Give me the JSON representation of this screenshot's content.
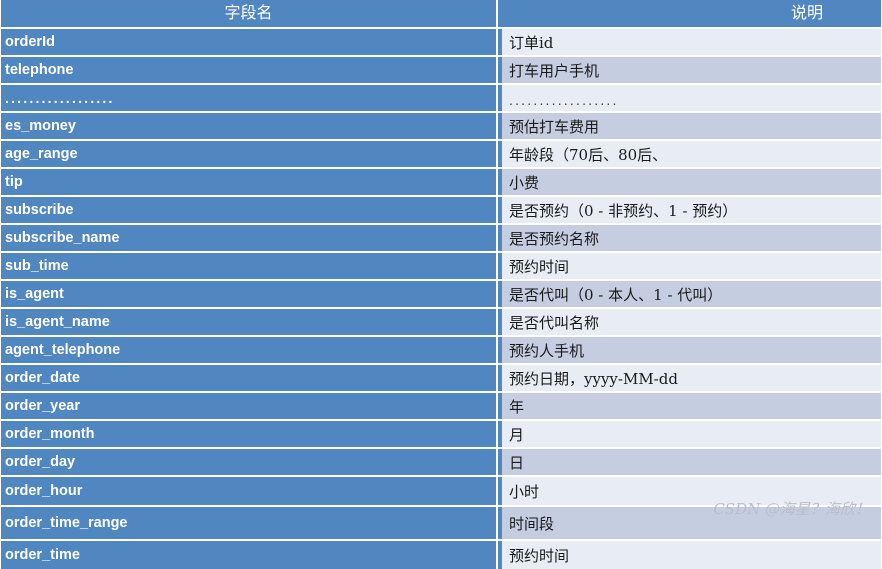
{
  "table": {
    "columns": [
      {
        "key": "name",
        "label": "字段名",
        "align": "center"
      },
      {
        "key": "desc",
        "label": "说明",
        "align": "right"
      }
    ],
    "colors": {
      "header_bg": "#5087C0",
      "header_text": "#FFFFFF",
      "name_col_bg": "#5087C0",
      "name_col_text": "#FFFFFF",
      "desc_row_shade_a": "#C4CEE0",
      "desc_row_shade_b": "#E8ECF4",
      "desc_accent_bar": "#5087C0",
      "page_bg": "#FFFFFF"
    },
    "rows": [
      {
        "name": "orderId",
        "desc": "订单id"
      },
      {
        "name": "telephone",
        "desc": "打车用户手机"
      },
      {
        "name": "..................",
        "desc": "..................",
        "is_ellipsis": true
      },
      {
        "name": "es_money",
        "desc": "预估打车费用"
      },
      {
        "name": "age_range",
        "desc": "年龄段（70后、80后、"
      },
      {
        "name": "tip",
        "desc": "小费"
      },
      {
        "name": "subscribe",
        "desc": "是否预约（0 - 非预约、1 - 预约）"
      },
      {
        "name": "subscribe_name",
        "desc": "是否预约名称"
      },
      {
        "name": "sub_time",
        "desc": "预约时间"
      },
      {
        "name": "is_agent",
        "desc": "是否代叫（0 - 本人、1 - 代叫）"
      },
      {
        "name": "is_agent_name",
        "desc": "是否代叫名称"
      },
      {
        "name": "agent_telephone",
        "desc": "预约人手机"
      },
      {
        "name": "order_date",
        "desc": "预约日期，yyyy-MM-dd"
      },
      {
        "name": "order_year",
        "desc": "年"
      },
      {
        "name": "order_month",
        "desc": "月"
      },
      {
        "name": "order_day",
        "desc": "日"
      },
      {
        "name": "order_hour",
        "desc": "小时"
      },
      {
        "name": "order_time_range",
        "desc": "时间段"
      },
      {
        "name": "order_time",
        "desc": "预约时间"
      }
    ]
  },
  "watermark": {
    "text": "CSDN @海星？海欣！"
  }
}
